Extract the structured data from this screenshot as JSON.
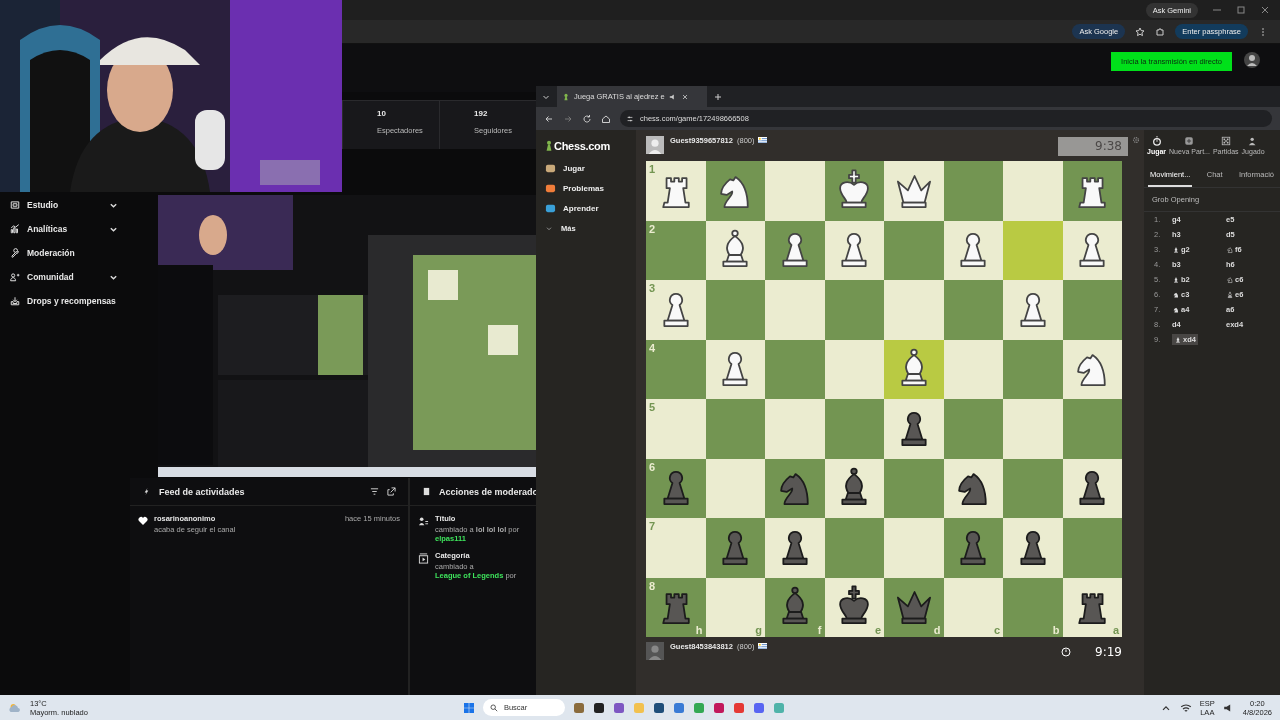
{
  "browser": {
    "gemini": "Ask Gemini",
    "ask_google": "Ask Google",
    "passphrase": "Enter passphrase"
  },
  "dashboard": {
    "go_live": "Inicia la transmisión en directo",
    "stats": [
      {
        "value": "10",
        "label": "Espectadores"
      },
      {
        "value": "192",
        "label": "Seguidores"
      }
    ],
    "nav": [
      {
        "label": "Estudio",
        "kind": "studio",
        "expandable": true
      },
      {
        "label": "Analíticas",
        "kind": "analytics",
        "expandable": true
      },
      {
        "label": "Moderación",
        "kind": "moderation",
        "expandable": false
      },
      {
        "label": "Comunidad",
        "kind": "community",
        "expandable": true
      },
      {
        "label": "Drops y recompensas",
        "kind": "drops",
        "expandable": false
      }
    ],
    "feed": {
      "title": "Feed de actividades",
      "items": [
        {
          "user": "rosarinoanonimo",
          "time": "hace 15 minutos",
          "text": "acaba de seguir el canal"
        }
      ]
    },
    "mod": {
      "title": "Acciones de moderado",
      "items": [
        {
          "title": "Título",
          "kind": "title",
          "prefix": "cambiado a",
          "value": "lol lol lol",
          "by": "por",
          "user": "elpas111"
        },
        {
          "title": "Categoría",
          "kind": "category",
          "prefix": "cambiado a",
          "value": "League of Legends",
          "by": "por"
        }
      ]
    }
  },
  "chess_window": {
    "tab_title": "Juega GRATIS al ajedrez e",
    "url": "chess.com/game/172498666508",
    "logo": "Chess.com",
    "nav": [
      {
        "label": "Jugar",
        "kind": "play"
      },
      {
        "label": "Problemas",
        "kind": "puzzles"
      },
      {
        "label": "Aprender",
        "kind": "learn"
      },
      {
        "label": "Más",
        "kind": "more"
      }
    ],
    "top_player": {
      "name": "Guest9359657812",
      "rating": "(800)",
      "clock": "9:38",
      "active": false
    },
    "bottom_player": {
      "name": "Guest8453843812",
      "rating": "(800)",
      "clock": "9:19",
      "active": true
    },
    "board": {
      "ranks": [
        "1",
        "2",
        "3",
        "4",
        "5",
        "6",
        "7",
        "8"
      ],
      "files": [
        "h",
        "g",
        "f",
        "e",
        "d",
        "c",
        "b",
        "a"
      ],
      "rows": [
        [
          {
            "kind": "rook",
            "white": true,
            "highlighted": false
          },
          {
            "kind": "knight",
            "white": true,
            "highlighted": false
          },
          {
            "kind": "none",
            "highlighted": false
          },
          {
            "kind": "king",
            "white": true,
            "highlighted": false
          },
          {
            "kind": "queen",
            "white": true,
            "highlighted": false
          },
          {
            "kind": "none",
            "highlighted": false
          },
          {
            "kind": "none",
            "highlighted": false
          },
          {
            "kind": "rook",
            "white": true,
            "highlighted": false
          }
        ],
        [
          {
            "kind": "none",
            "highlighted": false
          },
          {
            "kind": "bishop",
            "white": true,
            "highlighted": false
          },
          {
            "kind": "pawn",
            "white": true,
            "highlighted": false
          },
          {
            "kind": "pawn",
            "white": true,
            "highlighted": false
          },
          {
            "kind": "none",
            "highlighted": false
          },
          {
            "kind": "pawn",
            "white": true,
            "highlighted": false
          },
          {
            "kind": "none",
            "highlighted": true
          },
          {
            "kind": "pawn",
            "white": true,
            "highlighted": false
          }
        ],
        [
          {
            "kind": "pawn",
            "white": true,
            "highlighted": false
          },
          {
            "kind": "none",
            "highlighted": false
          },
          {
            "kind": "none",
            "highlighted": false
          },
          {
            "kind": "none",
            "highlighted": false
          },
          {
            "kind": "none",
            "highlighted": false
          },
          {
            "kind": "none",
            "highlighted": false
          },
          {
            "kind": "pawn",
            "white": true,
            "highlighted": false
          },
          {
            "kind": "none",
            "highlighted": false
          }
        ],
        [
          {
            "kind": "none",
            "highlighted": false
          },
          {
            "kind": "pawn",
            "white": true,
            "highlighted": false
          },
          {
            "kind": "none",
            "highlighted": false
          },
          {
            "kind": "none",
            "highlighted": false
          },
          {
            "kind": "bishop",
            "white": true,
            "highlighted": true
          },
          {
            "kind": "none",
            "highlighted": false
          },
          {
            "kind": "none",
            "highlighted": false
          },
          {
            "kind": "knight",
            "white": true,
            "highlighted": false
          }
        ],
        [
          {
            "kind": "none",
            "highlighted": false
          },
          {
            "kind": "none",
            "highlighted": false
          },
          {
            "kind": "none",
            "highlighted": false
          },
          {
            "kind": "none",
            "highlighted": false
          },
          {
            "kind": "pawn",
            "white": false,
            "highlighted": false
          },
          {
            "kind": "none",
            "highlighted": false
          },
          {
            "kind": "none",
            "highlighted": false
          },
          {
            "kind": "none",
            "highlighted": false
          }
        ],
        [
          {
            "kind": "pawn",
            "white": false,
            "highlighted": false
          },
          {
            "kind": "none",
            "highlighted": false
          },
          {
            "kind": "knight",
            "white": false,
            "highlighted": false
          },
          {
            "kind": "bishop",
            "white": false,
            "highlighted": false
          },
          {
            "kind": "none",
            "highlighted": false
          },
          {
            "kind": "knight",
            "white": false,
            "highlighted": false
          },
          {
            "kind": "none",
            "highlighted": false
          },
          {
            "kind": "pawn",
            "white": false,
            "highlighted": false
          }
        ],
        [
          {
            "kind": "none",
            "highlighted": false
          },
          {
            "kind": "pawn",
            "white": false,
            "highlighted": false
          },
          {
            "kind": "pawn",
            "white": false,
            "highlighted": false
          },
          {
            "kind": "none",
            "highlighted": false
          },
          {
            "kind": "none",
            "highlighted": false
          },
          {
            "kind": "pawn",
            "white": false,
            "highlighted": false
          },
          {
            "kind": "pawn",
            "white": false,
            "highlighted": false
          },
          {
            "kind": "none",
            "highlighted": false
          }
        ],
        [
          {
            "kind": "rook",
            "white": false,
            "highlighted": false
          },
          {
            "kind": "none",
            "highlighted": false
          },
          {
            "kind": "bishop",
            "white": false,
            "highlighted": false
          },
          {
            "kind": "king",
            "white": false,
            "highlighted": false
          },
          {
            "kind": "queen",
            "white": false,
            "highlighted": false
          },
          {
            "kind": "none",
            "highlighted": false
          },
          {
            "kind": "none",
            "highlighted": false
          },
          {
            "kind": "rook",
            "white": false,
            "highlighted": false
          }
        ]
      ]
    },
    "panel_tabs": [
      {
        "label": "Jugar",
        "kind": "play",
        "selected": true
      },
      {
        "label": "Nueva Part...",
        "kind": "new",
        "selected": false
      },
      {
        "label": "Partidas",
        "kind": "games",
        "selected": false
      },
      {
        "label": "Jugado",
        "kind": "players",
        "selected": false
      }
    ],
    "sub_tabs": [
      {
        "label": "Movimient...",
        "selected": true
      },
      {
        "label": "Chat",
        "selected": false
      },
      {
        "label": "Informació",
        "selected": false
      }
    ],
    "opening": "Grob Opening",
    "moves": [
      {
        "number": "1.",
        "white": {
          "move": "g4",
          "kind": "pawn"
        },
        "black": {
          "move": "e5",
          "kind": "pawn"
        },
        "selected": false
      },
      {
        "number": "2.",
        "white": {
          "move": "h3",
          "kind": "pawn"
        },
        "black": {
          "move": "d5",
          "kind": "pawn"
        },
        "selected": false
      },
      {
        "number": "3.",
        "white": {
          "move": "g2",
          "kind": "bishop"
        },
        "black": {
          "move": "f6",
          "kind": "knight"
        },
        "selected": false
      },
      {
        "number": "4.",
        "white": {
          "move": "b3",
          "kind": "pawn"
        },
        "black": {
          "move": "h6",
          "kind": "pawn"
        },
        "selected": false
      },
      {
        "number": "5.",
        "white": {
          "move": "b2",
          "kind": "bishop"
        },
        "black": {
          "move": "c6",
          "kind": "knight"
        },
        "selected": false
      },
      {
        "number": "6.",
        "white": {
          "move": "c3",
          "kind": "knight"
        },
        "black": {
          "move": "e6",
          "kind": "bishop"
        },
        "selected": false
      },
      {
        "number": "7.",
        "white": {
          "move": "a4",
          "kind": "knight"
        },
        "black": {
          "move": "a6",
          "kind": "pawn"
        },
        "selected": false
      },
      {
        "number": "8.",
        "white": {
          "move": "d4",
          "kind": "pawn"
        },
        "black": {
          "move": "exd4",
          "kind": "pawn"
        },
        "selected": false
      },
      {
        "number": "9.",
        "white": {
          "move": "xd4",
          "kind": "bishop"
        },
        "selected": true
      }
    ]
  },
  "taskbar": {
    "temperature": "13°C",
    "weather": "Mayorm. nublado",
    "search": "Buscar",
    "lang": "ESP",
    "layout": "LAA",
    "time": "0:20",
    "date": "4/8/2026"
  }
}
